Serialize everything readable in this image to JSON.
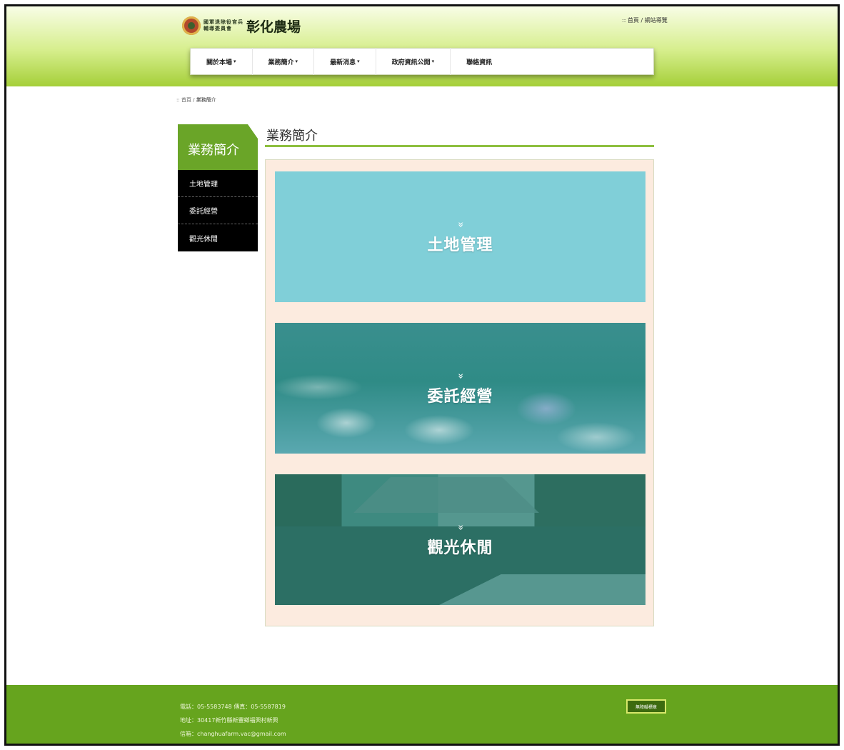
{
  "header": {
    "logo_sub_line1": "國軍退除役官兵",
    "logo_sub_line2": "輔導委員會",
    "logo_title": "彰化農場",
    "top_links": ":: 首頁 / 網站導覽"
  },
  "nav": {
    "items": [
      {
        "label": "關於本場",
        "caret": "▾"
      },
      {
        "label": "業務簡介",
        "caret": "▾"
      },
      {
        "label": "最新消息",
        "caret": "▾"
      },
      {
        "label": "政府資訊公開",
        "caret": "▾"
      },
      {
        "label": "聯絡資訊",
        "caret": ""
      }
    ]
  },
  "breadcrumb": {
    "home": ":: 首頁 /",
    "current": "業務簡介"
  },
  "sidebar": {
    "title": "業務簡介",
    "items": [
      {
        "label": "土地管理"
      },
      {
        "label": "委託經營"
      },
      {
        "label": "觀光休閒"
      }
    ]
  },
  "main": {
    "title": "業務簡介",
    "cards": [
      {
        "label": "土地管理",
        "chevron": "»"
      },
      {
        "label": "委託經營",
        "chevron": "»"
      },
      {
        "label": "觀光休閒",
        "chevron": "»"
      }
    ]
  },
  "footer": {
    "phone": "電話：05-5583748 傳真：05-5587819",
    "address": "地址：30417新竹縣新豐鄉福興村新興",
    "email": "信箱：changhuafarm.vac@gmail.com",
    "badge": "無障礙標章"
  }
}
